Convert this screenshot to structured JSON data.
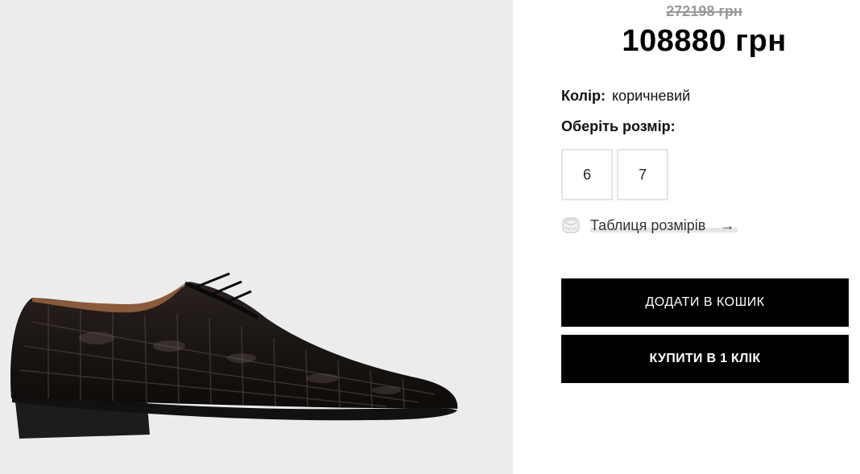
{
  "product": {
    "old_price": "272198 грн",
    "price": "108880 грн",
    "color_label": "Колір:",
    "color_value": "коричневий",
    "size_title": "Оберіть розмір:",
    "sizes": [
      "6",
      "7"
    ],
    "size_chart_label": "Таблиця розмірів",
    "size_chart_icon": "measuring-tape-icon",
    "arrow_icon": "arrow-right-icon"
  },
  "actions": {
    "add_to_cart": "ДОДАТИ В КОШИК",
    "buy_one_click": "КУПИТИ В 1 КЛІК"
  },
  "colors": {
    "image_background": "#ececec",
    "button_background": "#000000",
    "button_text": "#ffffff",
    "old_price": "#9a9a9a"
  }
}
